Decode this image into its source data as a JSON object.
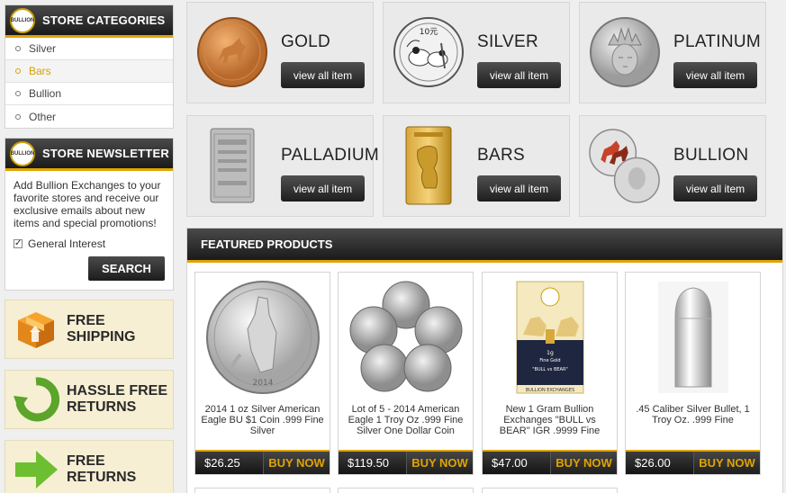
{
  "sidebar": {
    "categories": {
      "title": "STORE CATEGORIES",
      "badge": "BULLION",
      "items": [
        {
          "label": "Silver"
        },
        {
          "label": "Bars"
        },
        {
          "label": "Bullion"
        },
        {
          "label": "Other"
        }
      ]
    },
    "newsletter": {
      "title": "STORE NEWSLETTER",
      "badge": "BULLION",
      "text": "Add Bullion Exchanges to your favorite stores and receive our exclusive emails about new items and special promotions!",
      "checkbox_label": "General Interest",
      "search_label": "SEARCH"
    },
    "promos": [
      {
        "line1": "FREE",
        "line2": "SHIPPING",
        "icon": "box-icon"
      },
      {
        "line1": "HASSLE FREE",
        "line2": "RETURNS",
        "icon": "refresh-arrow-icon"
      },
      {
        "line1": "FREE",
        "line2": "RETURNS",
        "icon": "right-arrow-icon"
      }
    ]
  },
  "tiles": [
    {
      "name": "GOLD",
      "button": "view all item",
      "image": "gold-coin"
    },
    {
      "name": "SILVER",
      "button": "view all item",
      "image": "silver-panda-coin",
      "coin_text": "10元"
    },
    {
      "name": "PLATINUM",
      "button": "view all item",
      "image": "platinum-liberty-coin"
    },
    {
      "name": "PALLADIUM",
      "button": "view all item",
      "image": "palladium-bar"
    },
    {
      "name": "BARS",
      "button": "view all item",
      "image": "gold-bar"
    },
    {
      "name": "BULLION",
      "button": "view all item",
      "image": "colored-horse-coin"
    }
  ],
  "featured": {
    "title": "FEATURED PRODUCTS",
    "buy_label": "BUY NOW",
    "products": [
      {
        "title": "2014 1 oz Silver American Eagle BU $1 Coin .999 Fine Silver",
        "price": "$26.25",
        "coin_text": "2014"
      },
      {
        "title": "Lot of 5 - 2014 American Eagle 1 Troy Oz .999 Fine Silver One Dollar Coin",
        "price": "$119.50"
      },
      {
        "title": "New 1 Gram Bullion Exchanges \"BULL vs BEAR\" IGR .9999 Fine",
        "price": "$47.00",
        "card_text": [
          "1g",
          "Fine Gold",
          "\"BULL vs BEAR\""
        ],
        "brand": "BULLION EXCHANGES"
      },
      {
        "title": ".45 Caliber Silver Bullet, 1 Troy Oz. .999 Fine",
        "price": "$26.00"
      }
    ]
  },
  "colors": {
    "accent": "#e0a400",
    "dark": "#1a1a1a"
  }
}
